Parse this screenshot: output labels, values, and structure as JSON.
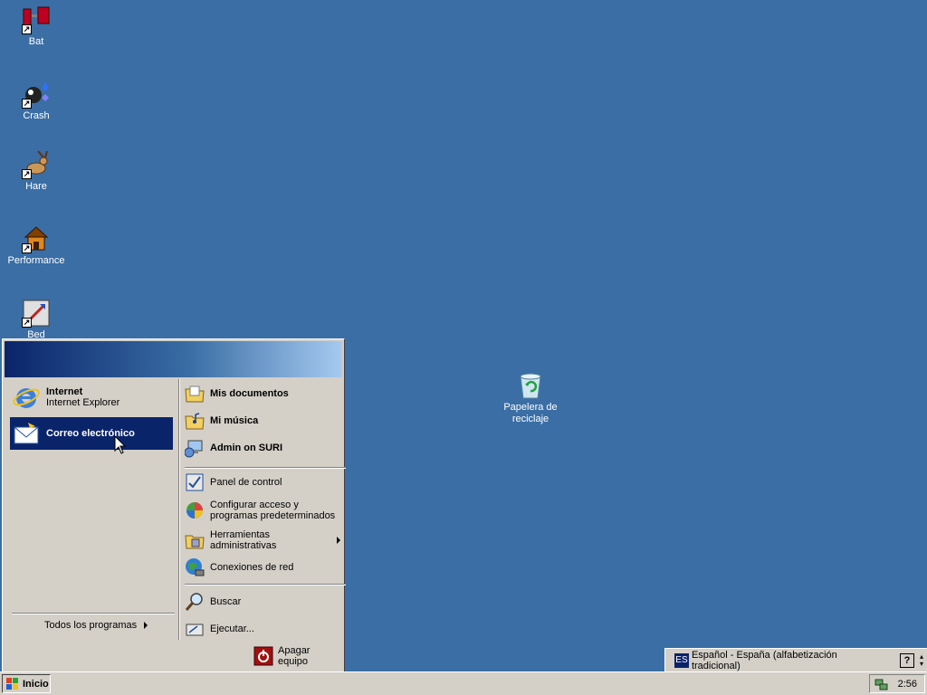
{
  "desktop": {
    "icons": [
      {
        "label": "Bat",
        "icon": "bat-shortcut-icon"
      },
      {
        "label": "Crash",
        "icon": "crash-shortcut-icon"
      },
      {
        "label": "Hare",
        "icon": "hare-shortcut-icon"
      },
      {
        "label": "Performance",
        "icon": "performance-shortcut-icon"
      },
      {
        "label": "Bed",
        "icon": "bed-shortcut-icon"
      }
    ],
    "recycle_bin": {
      "label_line1": "Papelera de",
      "label_line2": "reciclaje",
      "icon": "recycle-bin-icon"
    },
    "background_color": "#3a6ea5"
  },
  "start_menu": {
    "pinned": [
      {
        "title": "Internet",
        "subtitle": "Internet Explorer",
        "icon": "internet-explorer-icon"
      },
      {
        "title": "Correo electrónico",
        "icon": "email-envelope-icon",
        "selected": true
      }
    ],
    "all_programs": "Todos los programas",
    "right_items": [
      {
        "label": "Mis documentos",
        "icon": "folder-documents-icon",
        "bold": true
      },
      {
        "label": "Mi música",
        "icon": "folder-music-icon",
        "bold": true
      },
      {
        "label": "Admin on SURI",
        "icon": "network-computer-icon",
        "bold": true
      },
      {
        "label": "Panel de control",
        "icon": "control-panel-icon"
      },
      {
        "label_line1": "Configurar acceso y",
        "label_line2": "programas predeterminados",
        "icon": "default-programs-icon"
      },
      {
        "label": "Herramientas administrativas",
        "icon": "admin-tools-icon",
        "submenu": true
      },
      {
        "label": "Conexiones de red",
        "icon": "network-connections-icon"
      },
      {
        "label": "Buscar",
        "icon": "search-icon"
      },
      {
        "label": "Ejecutar...",
        "icon": "run-icon"
      }
    ],
    "shutdown_label": "Apagar equipo",
    "selection_color": "#0a246a"
  },
  "language_bar": {
    "code": "ES",
    "label": "Español - España (alfabetización tradicional)"
  },
  "taskbar": {
    "start_label": "Inicio",
    "clock": "2:56"
  }
}
